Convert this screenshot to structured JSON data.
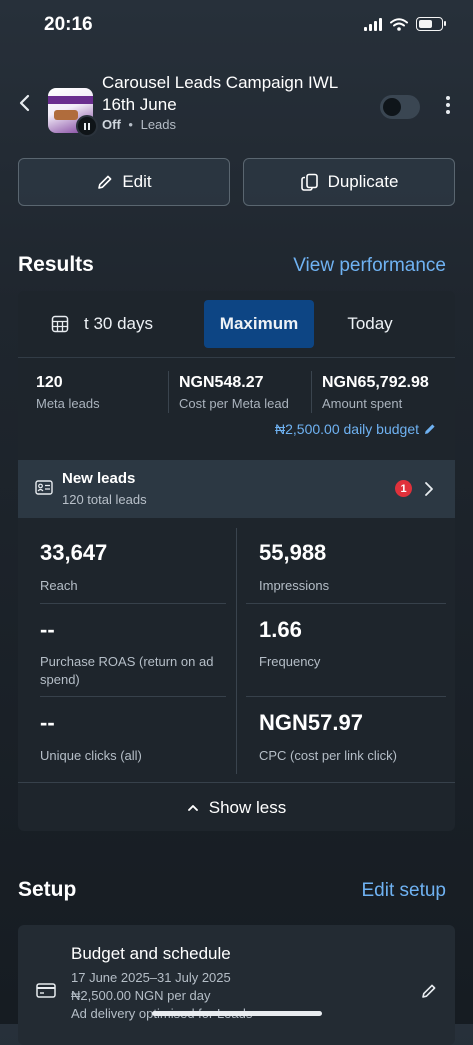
{
  "status": {
    "time": "20:16"
  },
  "campaign": {
    "title": "Carousel Leads Campaign IWL 16th June",
    "status": "Off",
    "separator": "•",
    "objective": "Leads"
  },
  "actions": {
    "edit": "Edit",
    "duplicate": "Duplicate"
  },
  "results": {
    "heading": "Results",
    "view_link": "View performance",
    "tabs": [
      {
        "label": "t 30 days",
        "active": false
      },
      {
        "label": "Maximum",
        "active": true
      },
      {
        "label": "Today",
        "active": false
      }
    ],
    "metrics": [
      {
        "value": "120",
        "label": "Meta leads"
      },
      {
        "value": "NGN548.27",
        "label": "Cost per Meta lead"
      },
      {
        "value": "NGN65,792.98",
        "label": "Amount spent"
      }
    ],
    "budget": "₦2,500.00 daily budget",
    "new_leads": {
      "title": "New leads",
      "subtitle": "120 total leads",
      "badge": "1"
    },
    "stats": [
      {
        "value": "33,647",
        "label": "Reach"
      },
      {
        "value": "55,988",
        "label": "Impressions"
      },
      {
        "value": "--",
        "label": "Purchase ROAS (return on ad spend)"
      },
      {
        "value": "1.66",
        "label": "Frequency"
      },
      {
        "value": "--",
        "label": "Unique clicks (all)"
      },
      {
        "value": "NGN57.97",
        "label": "CPC (cost per link click)"
      }
    ],
    "show_less": "Show less"
  },
  "setup": {
    "heading": "Setup",
    "edit_link": "Edit setup",
    "budget_schedule": {
      "title": "Budget and schedule",
      "dates": "17 June 2025–31 July 2025",
      "amount": "₦2,500.00 NGN per day",
      "delivery": "Ad delivery optimised for Leads"
    }
  },
  "icons": [
    "back-chevron-icon",
    "pause-icon",
    "pencil-icon",
    "duplicate-icon",
    "calendar-grid-icon",
    "lead-card-icon",
    "chevron-right-icon",
    "chevron-up-icon",
    "credit-card-icon"
  ]
}
